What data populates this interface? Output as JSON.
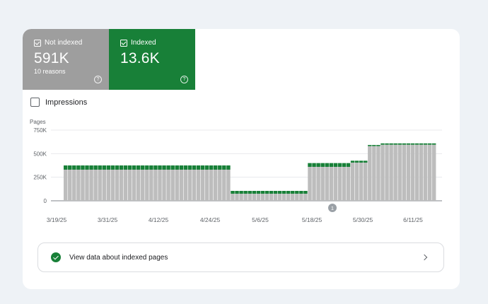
{
  "tiles": {
    "not_indexed": {
      "label": "Not indexed",
      "value": "591K",
      "sub": "10 reasons",
      "help": "?"
    },
    "indexed": {
      "label": "Indexed",
      "value": "13.6K",
      "help": "?"
    }
  },
  "impressions_label": "Impressions",
  "colors": {
    "not_indexed": "#bdbdbd",
    "indexed": "#188038",
    "grid": "#e8eaed"
  },
  "chart_data": {
    "type": "bar",
    "stacked": true,
    "ylabel": "Pages",
    "yticks": [
      "0",
      "250K",
      "500K",
      "750K"
    ],
    "ylim": [
      0,
      750000
    ],
    "xticks": [
      "3/19/25",
      "3/31/25",
      "4/12/25",
      "4/24/25",
      "5/6/25",
      "5/18/25",
      "5/30/25",
      "6/11/25"
    ],
    "annotation": "1",
    "series": [
      {
        "name": "Not indexed",
        "values": [
          330000,
          330000,
          330000,
          330000,
          330000,
          330000,
          330000,
          330000,
          330000,
          330000,
          330000,
          330000,
          330000,
          330000,
          330000,
          330000,
          330000,
          330000,
          330000,
          330000,
          330000,
          330000,
          330000,
          330000,
          330000,
          330000,
          330000,
          330000,
          330000,
          330000,
          330000,
          330000,
          330000,
          330000,
          330000,
          330000,
          330000,
          330000,
          330000,
          75000,
          75000,
          75000,
          75000,
          75000,
          75000,
          75000,
          75000,
          75000,
          75000,
          75000,
          75000,
          75000,
          75000,
          75000,
          75000,
          75000,
          75000,
          360000,
          360000,
          360000,
          360000,
          360000,
          360000,
          360000,
          360000,
          360000,
          360000,
          405000,
          405000,
          405000,
          405000,
          580000,
          580000,
          580000,
          595000,
          595000,
          595000,
          595000,
          595000,
          595000,
          595000,
          595000,
          595000,
          595000,
          595000,
          595000,
          595000
        ],
        "dates": "daily 3/19/25 - 6/15/25 (approx.)"
      },
      {
        "name": "Indexed",
        "values": [
          45000,
          45000,
          45000,
          45000,
          45000,
          45000,
          45000,
          45000,
          45000,
          45000,
          45000,
          45000,
          45000,
          45000,
          45000,
          45000,
          45000,
          45000,
          45000,
          45000,
          45000,
          45000,
          45000,
          45000,
          45000,
          45000,
          45000,
          45000,
          45000,
          45000,
          45000,
          45000,
          45000,
          45000,
          45000,
          45000,
          45000,
          45000,
          45000,
          30000,
          30000,
          30000,
          30000,
          30000,
          30000,
          30000,
          30000,
          30000,
          30000,
          30000,
          30000,
          30000,
          30000,
          30000,
          30000,
          30000,
          30000,
          40000,
          40000,
          40000,
          40000,
          40000,
          40000,
          40000,
          40000,
          40000,
          40000,
          20000,
          20000,
          20000,
          20000,
          12000,
          12000,
          12000,
          14000,
          14000,
          14000,
          14000,
          14000,
          14000,
          14000,
          14000,
          14000,
          14000,
          14000,
          14000,
          14000
        ]
      }
    ]
  },
  "link": {
    "text": "View data about indexed pages"
  }
}
